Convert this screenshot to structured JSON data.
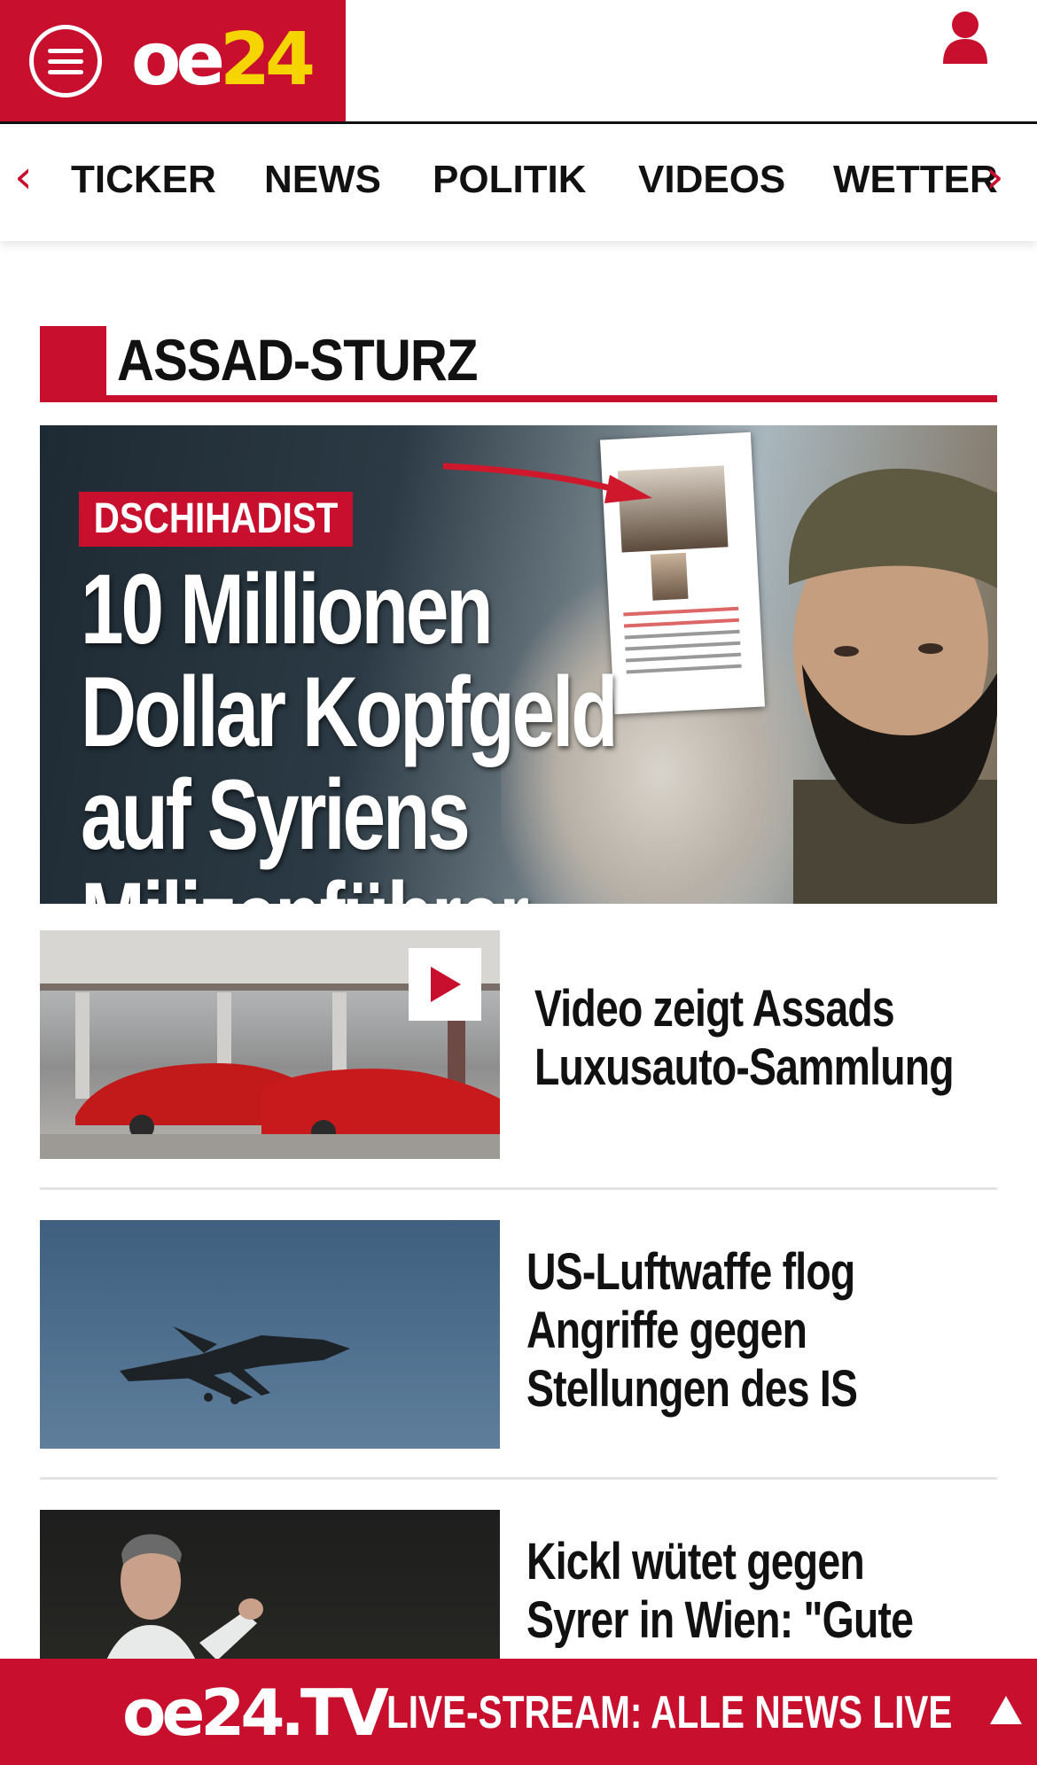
{
  "header": {
    "logo_oe": "oe",
    "logo_num": "24"
  },
  "nav": {
    "items": [
      {
        "label": "TICKER"
      },
      {
        "label": "NEWS"
      },
      {
        "label": "POLITIK"
      },
      {
        "label": "VIDEOS"
      },
      {
        "label": "WETTER"
      }
    ],
    "prev_icon": "chevron-left-icon",
    "next_icon": "chevron-right-icon"
  },
  "section": {
    "title": "ASSAD-STURZ"
  },
  "hero": {
    "tag": "DSCHIHADIST",
    "title_line1": "10 Millionen",
    "title_line2": "Dollar Kopfgeld",
    "title_line3": "auf Syriens Milizenführer"
  },
  "articles": [
    {
      "headline": "Video zeigt Assads Luxusauto-Sammlung",
      "has_video": true
    },
    {
      "headline": "US-Luftwaffe flog Angriffe gegen Stellungen des IS"
    },
    {
      "headline": "Kickl wütet gegen Syrer in Wien: \"Gute"
    }
  ],
  "bottom_bar": {
    "logo": "oe24.TV",
    "text": "LIVE-STREAM:  ALLE NEWS LIVE"
  },
  "colors": {
    "brand_red": "#c8102e",
    "logo_yellow": "#f5d400"
  }
}
